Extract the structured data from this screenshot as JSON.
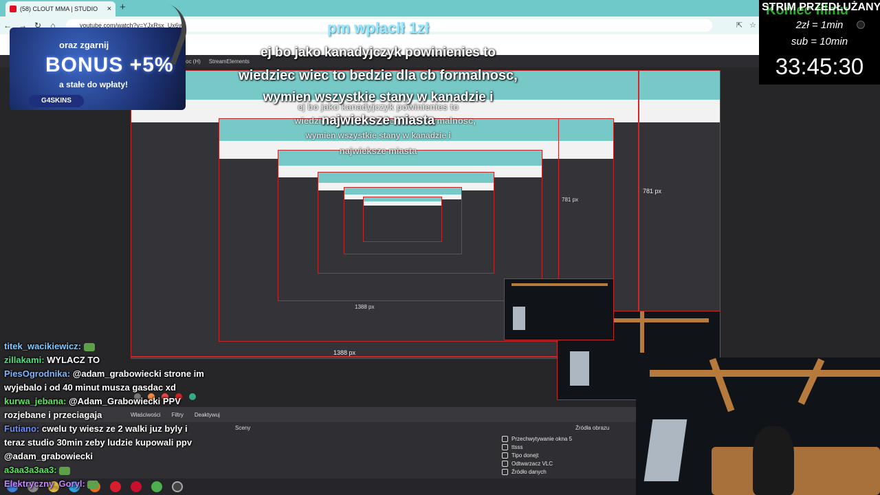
{
  "browser": {
    "tab_title": "(58) CLOUT MMA | STUDIO",
    "new_tab": "+",
    "url": "youtube.com/watch?v=YJxRsx_Ux6w",
    "nav": {
      "back": "←",
      "forward": "→",
      "reload": "↻",
      "home": "⌂"
    }
  },
  "obs": {
    "menu": [
      "oc (H)",
      "StreamElements"
    ],
    "tabs": [
      "Właściwości",
      "Filtry",
      "Deaktywuj"
    ],
    "scenes_label": "Sceny",
    "sources_label": "Źródła obrazu",
    "sources": [
      "Przechwytywanie okna 5",
      "ttsss",
      "Tipo donejt",
      "Odtwarzacz VLC",
      "Źródło danych"
    ],
    "px_labels": {
      "w1": "1388 px",
      "w2": "1388 px",
      "h1": "781 px",
      "h2": "781 px"
    }
  },
  "overlay": {
    "donation": "pm wpłacił 1zł",
    "caption": [
      "ej bo jako kanadyjczyk powinienies to",
      "wiedziec wiec to bedzie dla cb formalnosc,",
      "wymien wszystkie stany w kanadzie i",
      "najwieksze miasta"
    ],
    "ad": {
      "line1": "oraz zgarnij",
      "line2": "BONUS +5%",
      "line3": "a stałe do wpłaty!",
      "brand": "G4SKINS"
    },
    "info": {
      "title": "STRIM PRZEDŁUŻANY",
      "subtitle": "Koniec filmu",
      "rate1": "2zł = 1min",
      "rate2": "sub = 10min",
      "timer": "33:45:30"
    }
  },
  "chat": [
    {
      "user": "titek_wacikiewicz:",
      "color": "#7fc7ff",
      "text": "",
      "emote": true
    },
    {
      "user": "zillakami:",
      "color": "#4fe07f",
      "text": "WYLACZ TO",
      "emote": false
    },
    {
      "user": "PiesOgrodnika:",
      "color": "#7fb4ff",
      "text": "@adam_grabowiecki strone im",
      "emote": false
    },
    {
      "user": "",
      "color": "#fff",
      "text": "wyjebalo i od 40 minut musza gasdac xd",
      "emote": false
    },
    {
      "user": "kurwa_jebana:",
      "color": "#5ee35e",
      "text": "@Adam_Grabowiecki PPV",
      "emote": false
    },
    {
      "user": "",
      "color": "#fff",
      "text": "rozjebane i przeciagaja",
      "emote": false
    },
    {
      "user": "Futiano:",
      "color": "#6b8cff",
      "text": "cwelu ty wiesz ze 2 walki juz byly i",
      "emote": false
    },
    {
      "user": "",
      "color": "#fff",
      "text": "teraz studio 30min zeby ludzie kupowali ppv",
      "emote": false
    },
    {
      "user": "",
      "color": "#fff",
      "text": "@adam_grabowiecki",
      "emote": false
    },
    {
      "user": "a3aa3a3aa3:",
      "color": "#5ee35e",
      "text": "",
      "emote": true
    },
    {
      "user": "Elektryczny_Goryl:",
      "color": "#c583ff",
      "text": "",
      "emote": true
    }
  ],
  "colors": {
    "accent_teal": "#6fc9c9",
    "outline_red": "#d4262a",
    "timer_bg": "#000000"
  }
}
